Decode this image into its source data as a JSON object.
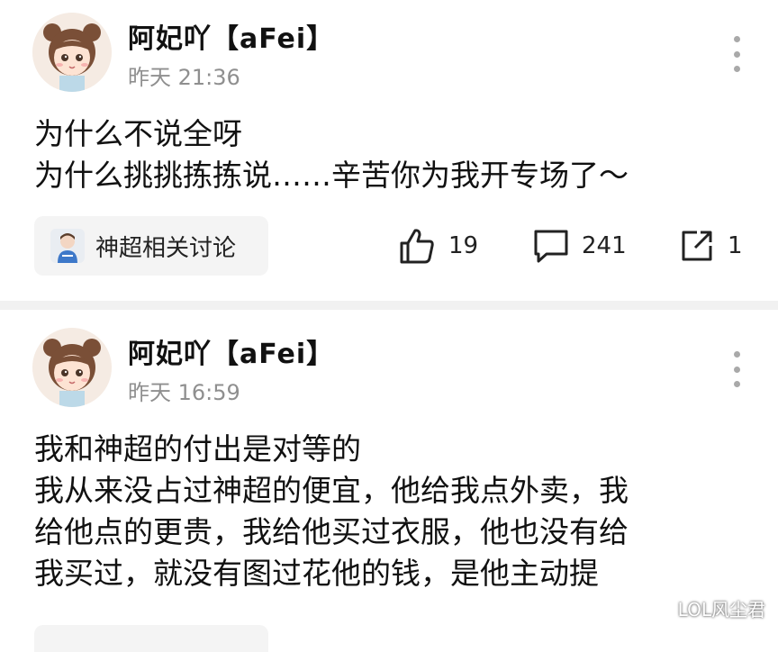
{
  "posts": [
    {
      "username": "阿妃吖【aFei】",
      "timestamp": "昨天 21:36",
      "content_lines": [
        "为什么不说全呀",
        "为什么挑挑拣拣说……辛苦你为我开专场了～"
      ],
      "topic": {
        "label": "神超相关讨论",
        "icon": "topic-avatar-icon"
      },
      "actions": {
        "like": {
          "icon": "thumbs-up-icon",
          "count": "19"
        },
        "comment": {
          "icon": "comment-bubble-icon",
          "count": "241"
        },
        "share": {
          "icon": "share-icon",
          "count": "1"
        }
      }
    },
    {
      "username": "阿妃吖【aFei】",
      "timestamp": "昨天 16:59",
      "content_lines": [
        "我和神超的付出是对等的",
        "我从来没占过神超的便宜，他给我点外卖，我",
        "给他点的更贵，我给他买过衣服，他也没有给",
        "我买过，就没有图过花他的钱，是他主动提"
      ]
    }
  ],
  "watermark": "LOL风尘君",
  "colors": {
    "background": "#ffffff",
    "divider": "#f1f1f1",
    "secondary_text": "#8f8f8f",
    "chip_bg": "#f4f4f4"
  }
}
